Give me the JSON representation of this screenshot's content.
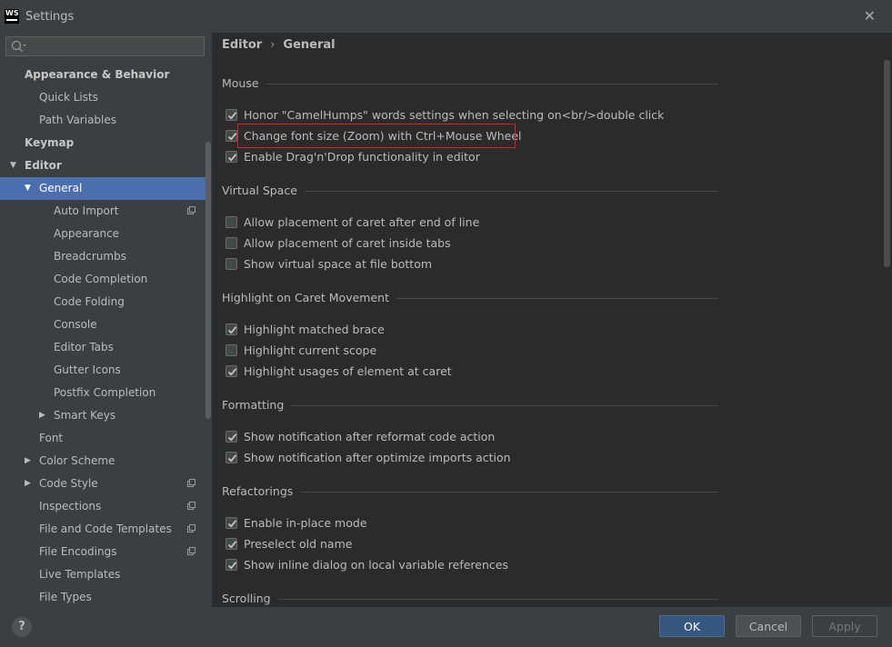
{
  "window": {
    "title": "Settings",
    "logo_text": "WS"
  },
  "search": {
    "value": ""
  },
  "tree": [
    {
      "label": "Appearance & Behavior",
      "name": "tree-item-appearance-behavior",
      "bold": true
    },
    {
      "label": "Quick Lists",
      "name": "tree-item-quick-lists"
    },
    {
      "label": "Path Variables",
      "name": "tree-item-path-variables"
    },
    {
      "label": "Keymap",
      "name": "tree-item-keymap",
      "bold": true
    },
    {
      "label": "Editor",
      "name": "tree-item-editor",
      "bold": true,
      "arrow": "expanded"
    },
    {
      "label": "General",
      "name": "tree-item-general",
      "arrow": "expanded",
      "selected": true
    },
    {
      "label": "Auto Import",
      "name": "tree-item-auto-import",
      "project": true
    },
    {
      "label": "Appearance",
      "name": "tree-item-appearance"
    },
    {
      "label": "Breadcrumbs",
      "name": "tree-item-breadcrumbs"
    },
    {
      "label": "Code Completion",
      "name": "tree-item-code-completion"
    },
    {
      "label": "Code Folding",
      "name": "tree-item-code-folding"
    },
    {
      "label": "Console",
      "name": "tree-item-console"
    },
    {
      "label": "Editor Tabs",
      "name": "tree-item-editor-tabs"
    },
    {
      "label": "Gutter Icons",
      "name": "tree-item-gutter-icons"
    },
    {
      "label": "Postfix Completion",
      "name": "tree-item-postfix-completion"
    },
    {
      "label": "Smart Keys",
      "name": "tree-item-smart-keys",
      "arrow": "collapsed"
    },
    {
      "label": "Font",
      "name": "tree-item-font"
    },
    {
      "label": "Color Scheme",
      "name": "tree-item-color-scheme",
      "arrow": "collapsed"
    },
    {
      "label": "Code Style",
      "name": "tree-item-code-style",
      "arrow": "collapsed",
      "project": true
    },
    {
      "label": "Inspections",
      "name": "tree-item-inspections",
      "project": true
    },
    {
      "label": "File and Code Templates",
      "name": "tree-item-file-code-templates",
      "project": true
    },
    {
      "label": "File Encodings",
      "name": "tree-item-file-encodings",
      "project": true
    },
    {
      "label": "Live Templates",
      "name": "tree-item-live-templates"
    },
    {
      "label": "File Types",
      "name": "tree-item-file-types"
    }
  ],
  "breadcrumb": {
    "parent": "Editor",
    "separator": "›",
    "current": "General"
  },
  "sections": [
    {
      "title": "Mouse",
      "options": [
        {
          "label": "Honor \"CamelHumps\" words settings when selecting on<br/>double click",
          "checked": true
        },
        {
          "label": "Change font size (Zoom) with Ctrl+Mouse Wheel",
          "checked": true
        },
        {
          "label": "Enable Drag'n'Drop functionality in editor",
          "checked": true
        }
      ]
    },
    {
      "title": "Virtual Space",
      "options": [
        {
          "label": "Allow placement of caret after end of line",
          "checked": false
        },
        {
          "label": "Allow placement of caret inside tabs",
          "checked": false
        },
        {
          "label": "Show virtual space at file bottom",
          "checked": false
        }
      ]
    },
    {
      "title": "Highlight on Caret Movement",
      "options": [
        {
          "label": "Highlight matched brace",
          "checked": true
        },
        {
          "label": "Highlight current scope",
          "checked": false
        },
        {
          "label": "Highlight usages of element at caret",
          "checked": true
        }
      ]
    },
    {
      "title": "Formatting",
      "options": [
        {
          "label": "Show notification after reformat code action",
          "checked": true
        },
        {
          "label": "Show notification after optimize imports action",
          "checked": true
        }
      ]
    },
    {
      "title": "Refactorings",
      "options": [
        {
          "label": "Enable in-place mode",
          "checked": true
        },
        {
          "label": "Preselect old name",
          "checked": true
        },
        {
          "label": "Show inline dialog on local variable references",
          "checked": true
        }
      ]
    },
    {
      "title": "Scrolling",
      "options": []
    }
  ],
  "footer": {
    "help": "?",
    "ok": "OK",
    "cancel": "Cancel",
    "apply": "Apply"
  },
  "colors": {
    "accent": "#4b6eaf",
    "ok_button": "#365880",
    "highlight_box": "#e21c27",
    "background": "#2b2b2b"
  }
}
